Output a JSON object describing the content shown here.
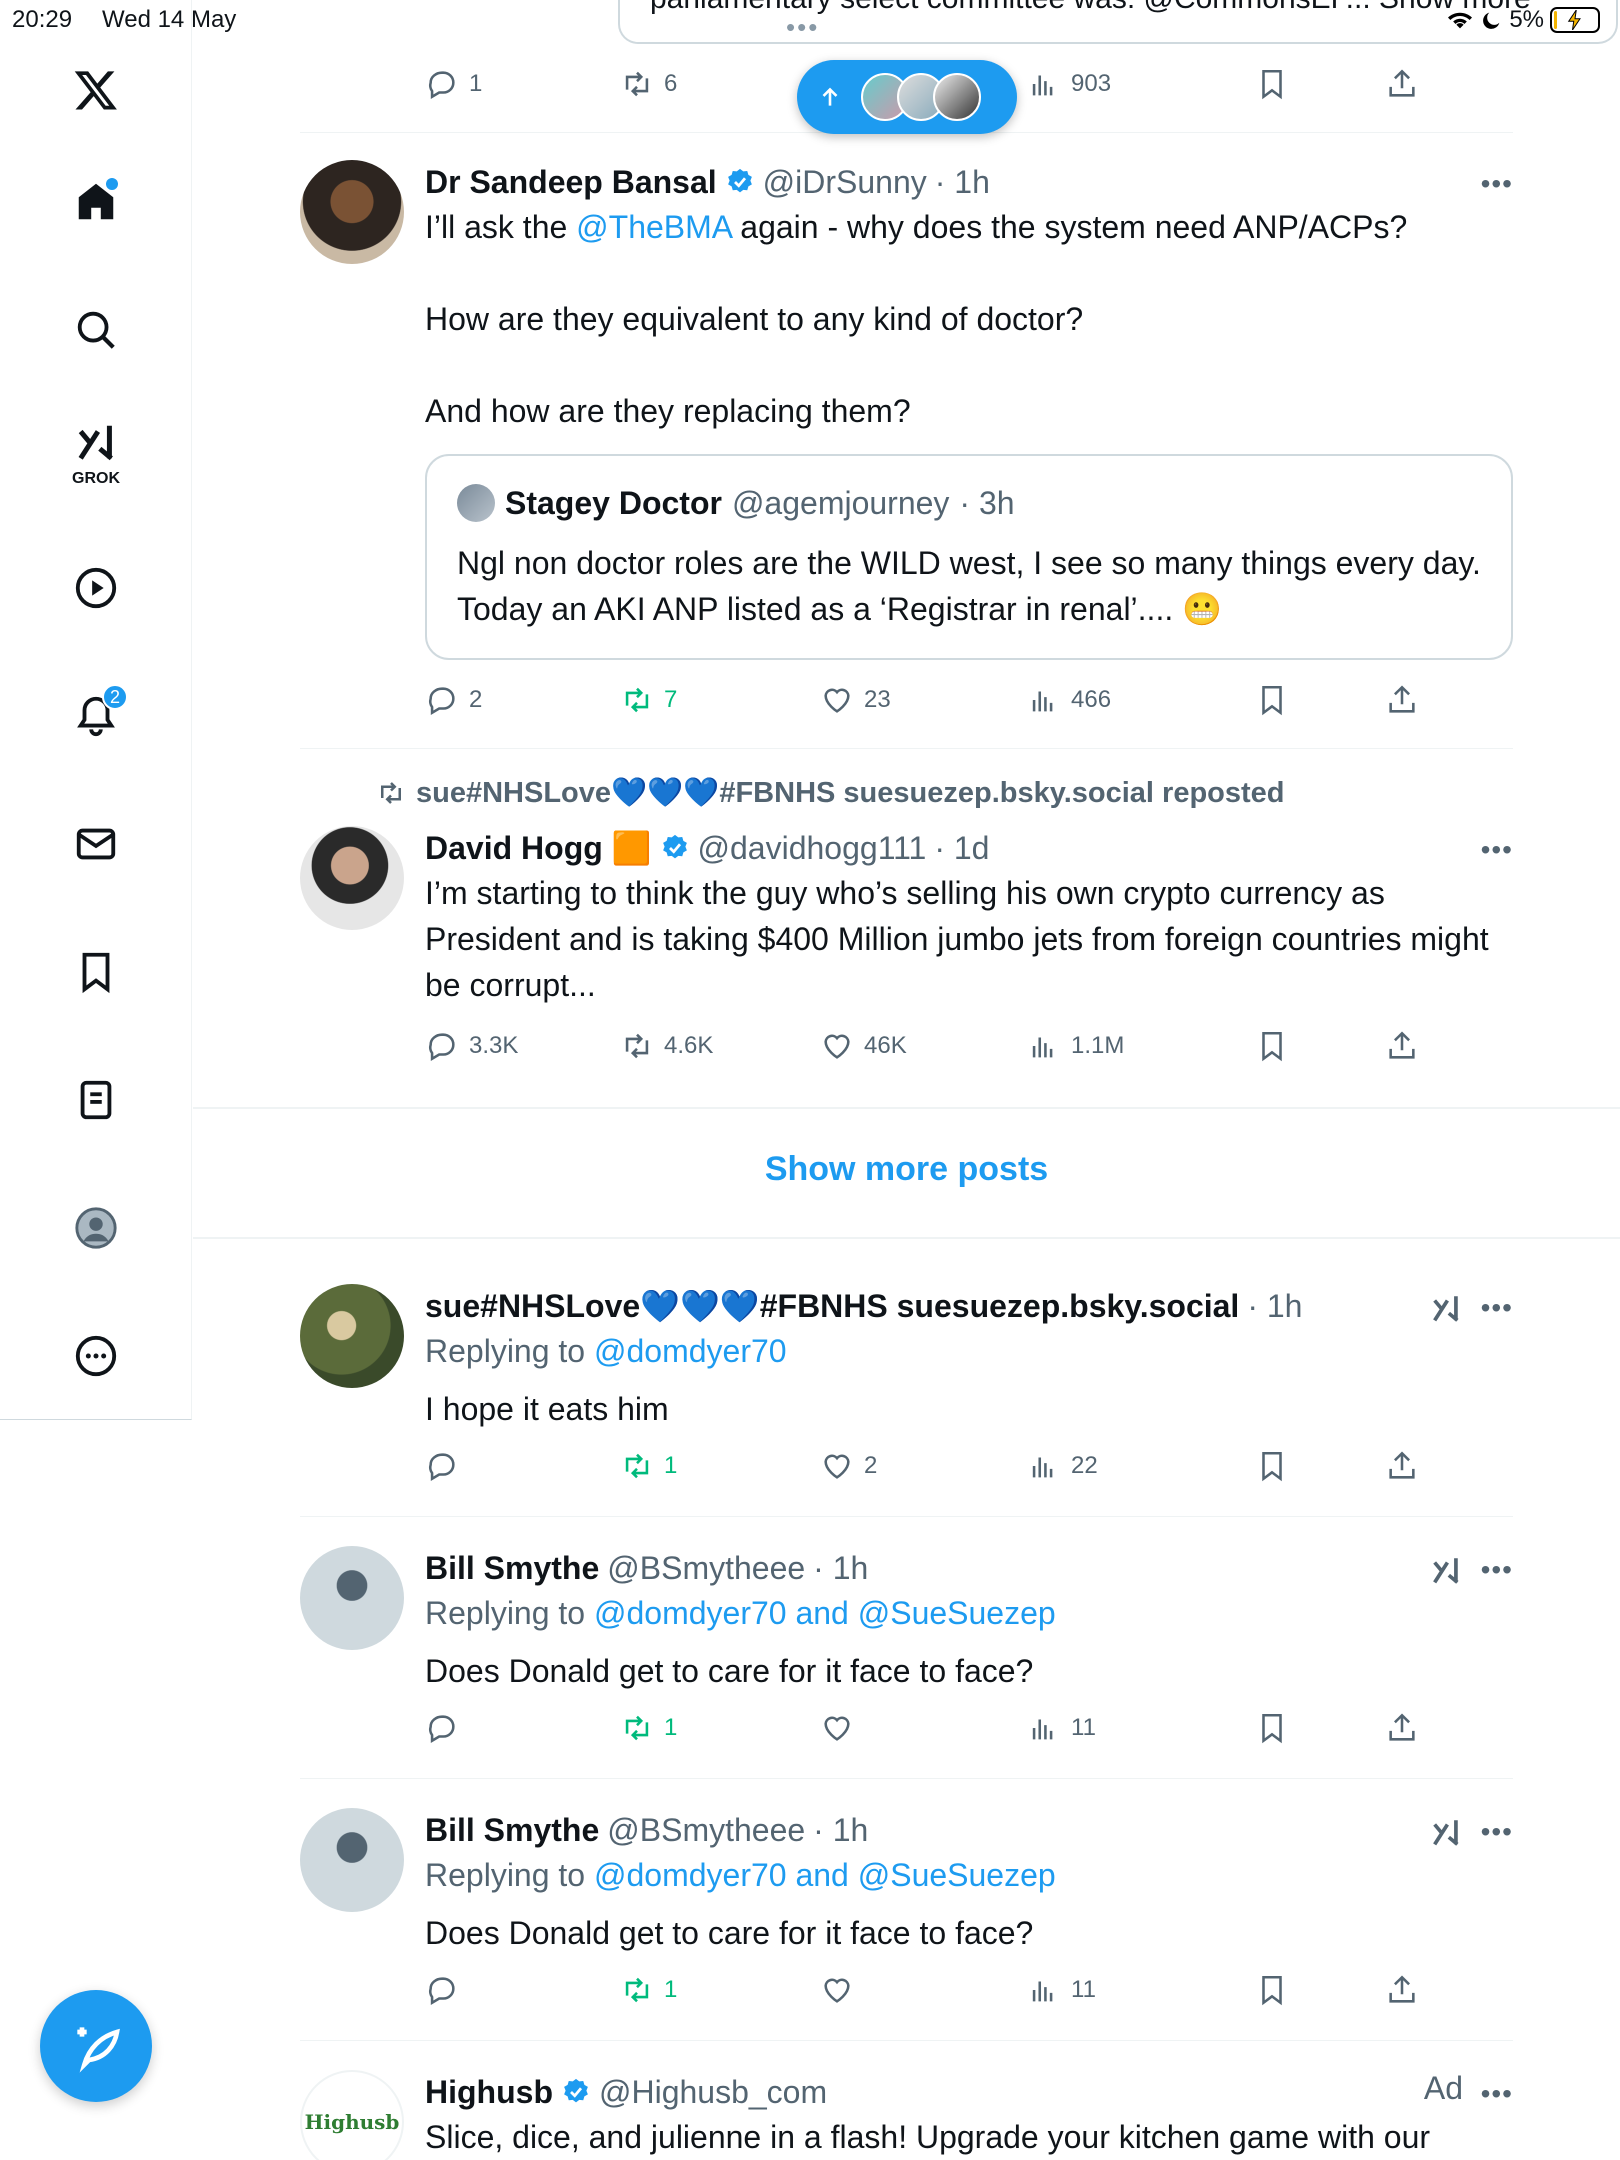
{
  "status_bar": {
    "time": "20:29",
    "date": "Wed 14 May",
    "battery": "5%"
  },
  "sidebar": {
    "grok_label": "GROK",
    "notifications_badge": "2"
  },
  "top_stub": {
    "text": "parliamentary select committee was: @CommonsEF... Show more",
    "actions": {
      "replies": "1",
      "reposts": "6",
      "views": "903"
    }
  },
  "posts": [
    {
      "name": "Dr Sandeep Bansal",
      "handle": "@iDrSunny",
      "time": "· 1h",
      "text_parts": [
        "I’ll ask the ",
        "@TheBMA",
        " again - why does the system need ANP/ACPs?"
      ],
      "text2": "How are they equivalent to any kind of doctor?",
      "text3": "And how are they replacing them?",
      "quote": {
        "name": "Stagey Doctor",
        "handle": "@agemjourney",
        "time": "· 3h",
        "text": "Ngl non doctor roles are the WILD west, I see so many things every day. Today an AKI ANP listed as a ‘Registrar in renal’.... 😬"
      },
      "actions": {
        "replies": "2",
        "reposts": "7",
        "likes": "23",
        "views": "466"
      }
    },
    {
      "repost_by": "sue#NHSLove💙💙💙#FBNHS suesuezep.bsky.social reposted",
      "name": "David Hogg 🟧",
      "handle": "@davidhogg111",
      "time": "· 1d",
      "text": "I’m starting to think the guy who’s selling his own crypto currency as President and is taking $400 Million jumbo jets from foreign countries might be corrupt...",
      "actions": {
        "replies": "3.3K",
        "reposts": "4.6K",
        "likes": "46K",
        "views": "1.1M"
      }
    },
    {
      "name": "sue#NHSLove💙💙💙#FBNHS suesuezep.bsky.social",
      "time": "· 1h",
      "replying_label": "Replying to ",
      "replying_to": "@domdyer70",
      "text": "I hope it eats him",
      "actions": {
        "reposts": "1",
        "likes": "2",
        "views": "22"
      }
    },
    {
      "name": "Bill Smythe",
      "handle": "@BSmytheee",
      "time": "· 1h",
      "replying_label": "Replying to ",
      "replying_to": "@domdyer70 and @SueSuezep",
      "text": "Does Donald get to care for it face to face?",
      "actions": {
        "reposts": "1",
        "views": "11"
      }
    },
    {
      "name": "Bill Smythe",
      "handle": "@BSmytheee",
      "time": "· 1h",
      "replying_label": "Replying to ",
      "replying_to": "@domdyer70 and @SueSuezep",
      "text": "Does Donald get to care for it face to face?",
      "actions": {
        "reposts": "1",
        "views": "11"
      }
    },
    {
      "name": "Highusb",
      "handle": "@Highusb_com",
      "ad_label": "Ad",
      "avatar_text": "Highusb",
      "text": "Slice, dice, and julienne in a flash! Upgrade your kitchen game with our"
    }
  ],
  "show_more_label": "Show more posts",
  "colors": {
    "accent": "#1d9bf0",
    "repost_green": "#00ba7c",
    "muted": "#536471"
  }
}
